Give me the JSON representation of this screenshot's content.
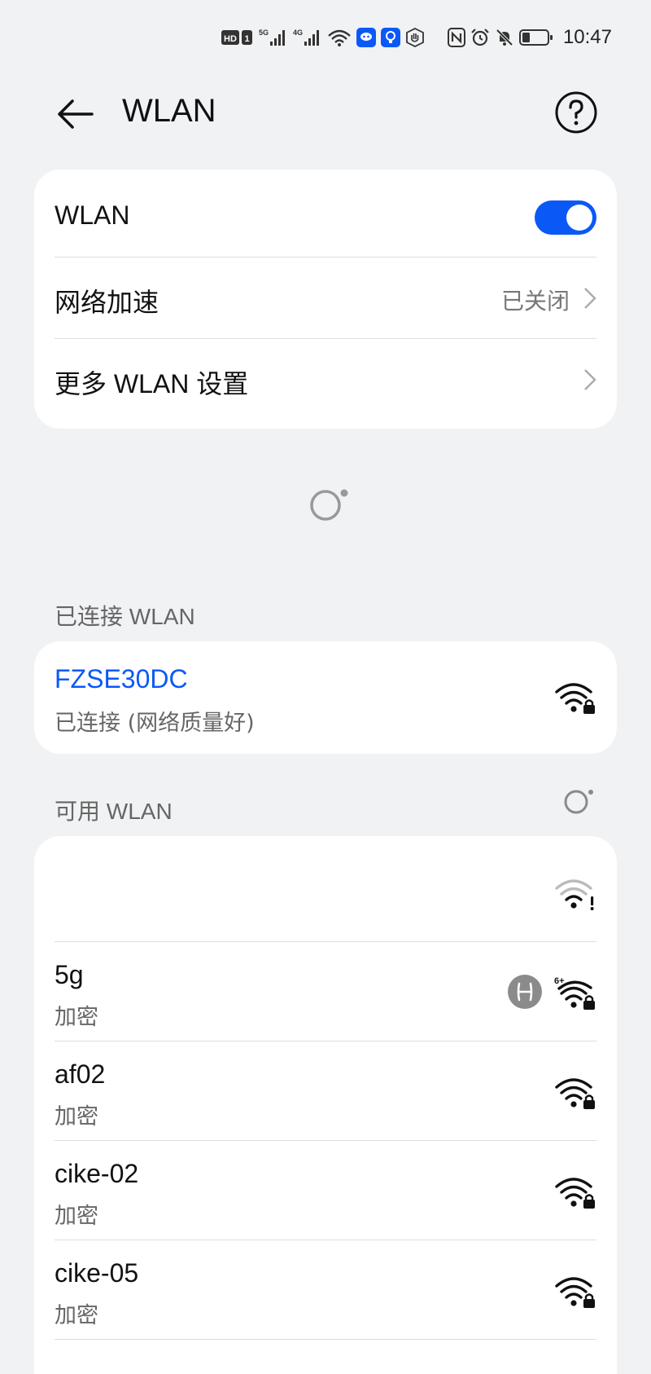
{
  "status_bar": {
    "time": "10:47",
    "hd_label": "HD",
    "sim_label": "1",
    "signal1_label": "5G",
    "signal2_label": "4G",
    "icons": [
      "hd-icon",
      "signal-5g-icon",
      "signal-4g-icon",
      "wifi-icon",
      "app-notification-icon",
      "bulb-app-icon",
      "hand-app-icon",
      "nfc-icon",
      "alarm-icon",
      "mute-icon",
      "battery-icon"
    ]
  },
  "header": {
    "title": "WLAN",
    "back_icon": "arrow-left-icon",
    "help_icon": "question-circle-icon"
  },
  "settings": {
    "wlan_label": "WLAN",
    "wlan_enabled": true,
    "accel_label": "网络加速",
    "accel_value": "已关闭",
    "more_label": "更多 WLAN 设置"
  },
  "connected": {
    "section_title": "已连接 WLAN",
    "ssid": "FZSE30DC",
    "status": "已连接 (网络质量好)"
  },
  "available": {
    "section_title": "可用 WLAN",
    "networks": [
      {
        "ssid": "",
        "security": "",
        "icon": "wifi-warning-icon"
      },
      {
        "ssid": "5g",
        "security": "加密",
        "icon": "wifi-6-lock-icon",
        "wifi6_label": "6+",
        "badge": "harmony-icon"
      },
      {
        "ssid": "af02",
        "security": "加密",
        "icon": "wifi-lock-icon"
      },
      {
        "ssid": "cike-02",
        "security": "加密",
        "icon": "wifi-lock-icon"
      },
      {
        "ssid": "cike-05",
        "security": "加密",
        "icon": "wifi-lock-icon"
      }
    ]
  },
  "colors": {
    "accent": "#0a59f7",
    "background": "#f1f2f4",
    "card": "#ffffff",
    "secondary_text": "#666666"
  }
}
